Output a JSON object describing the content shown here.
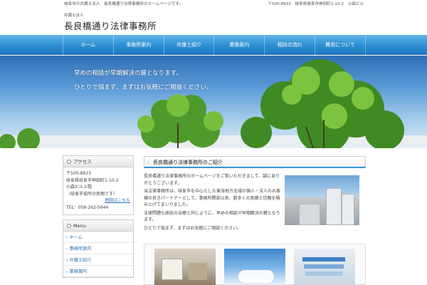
{
  "topbar": {
    "tagline": "岐阜市の弁護士法人　長良橋通り法律事務所のホームページです。",
    "address": "〒500-8833　岐阜県岐阜市神田町1-10-2　小森ビル"
  },
  "brand": {
    "subtitle": "弁護士法人",
    "title": "長良橋通り法律事務所"
  },
  "nav": {
    "items": [
      "ホーム",
      "事務所案内",
      "弁護士紹介",
      "業務案内",
      "相談の流れ",
      "費用について"
    ]
  },
  "hero": {
    "line1": "早めの相談が早期解決の鍵となります。",
    "line2": "ひとりで悩まず、まずはお気軽にご相談ください。"
  },
  "access": {
    "heading": "アクセス",
    "postal": "〒500-8833",
    "address1": "岐阜県岐阜市神田町1-10-2",
    "address2": "小森ビル２階",
    "note": "（岐阜市役所の南側です）",
    "map_link": "地図はこちら",
    "tel": "TEL：058-262-5644"
  },
  "menu": {
    "heading": "Menu",
    "items": [
      "ホーム",
      "事務所案内",
      "弁護士紹介",
      "業務案内"
    ]
  },
  "intro": {
    "heading": "長良橋通り法律事務所のご紹介",
    "p1": "長良橋通り法律事務所のホームページをご覧いただきまして、誠にありがとうございます。",
    "p2": "当法律事務所は、岐阜市を中心とした東海地方全域の個人・法人のお客様の良きパートナーとして、事務所開設以来、数多くの実績と信頼を積み上げてまいりました。",
    "p3": "法律問題も病気の治療と同じように、早めの相談が早期解決の鍵となります。",
    "p4": "ひとりで悩まず、まずはお気軽にご相談ください。"
  },
  "colors": {
    "nav_top": "#5fb6e6",
    "nav_bottom": "#2178bf",
    "link": "#2a6fb5",
    "accent": "#3a94d4"
  }
}
